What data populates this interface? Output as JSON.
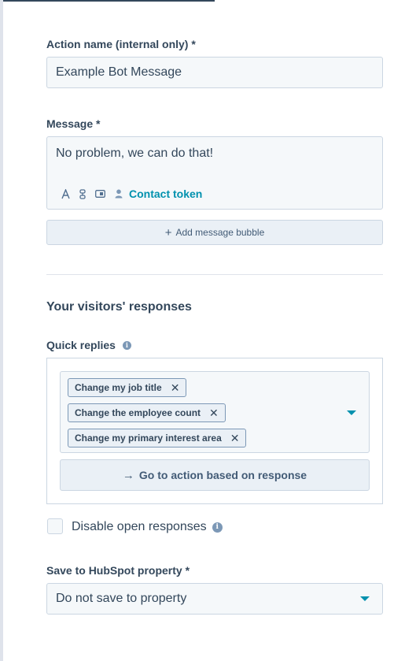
{
  "action_name": {
    "label": "Action name (internal only) *",
    "value": "Example Bot Message"
  },
  "message": {
    "label": "Message *",
    "value": "No problem, we can do that!",
    "toolbar": {
      "icons": [
        "text-format-icon",
        "snippet-icon",
        "video-icon"
      ],
      "contact_token_label": "Contact token"
    },
    "add_bubble_label": "Add message bubble"
  },
  "responses": {
    "heading": "Your visitors' responses",
    "quick_replies_label": "Quick replies",
    "tags": [
      "Change my job title",
      "Change the employee count",
      "Change my primary interest area"
    ],
    "go_to_action_label": "Go to action based on response"
  },
  "disable_open": {
    "label": "Disable open responses",
    "checked": false
  },
  "save_property": {
    "label": "Save to HubSpot property *",
    "value": "Do not save to property"
  },
  "colors": {
    "text": "#33475b",
    "accent": "#0091ae",
    "input_bg": "#f5f8fa",
    "border": "#cbd6e2",
    "button_bg": "#eaf0f6"
  }
}
